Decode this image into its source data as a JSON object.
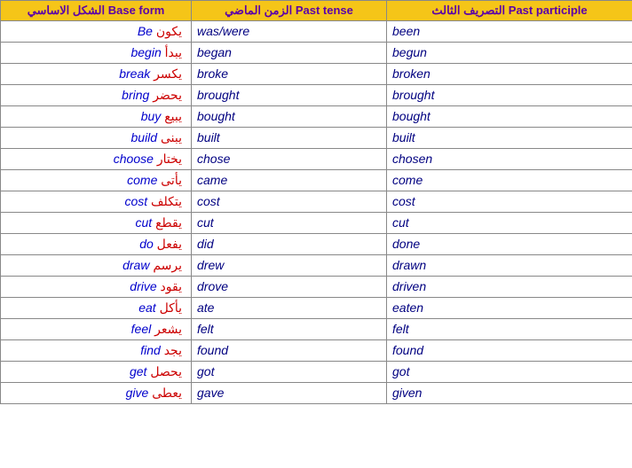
{
  "header": {
    "col1": {
      "en": "Base form",
      "ar": "الشكل الاساسي"
    },
    "col2": {
      "en": "Past tense",
      "ar": "الزمن الماضي"
    },
    "col3": {
      "en": "Past participle",
      "ar": "التصريف الثالث"
    }
  },
  "rows": [
    {
      "base_en": "Be",
      "base_ar": "يكون",
      "past": "was/were",
      "participle": "been"
    },
    {
      "base_en": "begin",
      "base_ar": "يبدأ",
      "past": "began",
      "participle": "begun"
    },
    {
      "base_en": "break",
      "base_ar": "يكسر",
      "past": "broke",
      "participle": "broken"
    },
    {
      "base_en": "bring",
      "base_ar": "يحضر",
      "past": "brought",
      "participle": "brought"
    },
    {
      "base_en": "buy",
      "base_ar": "يبيع",
      "past": "bought",
      "participle": "bought"
    },
    {
      "base_en": "build",
      "base_ar": "يبنى",
      "past": "built",
      "participle": "built"
    },
    {
      "base_en": "choose",
      "base_ar": "يختار",
      "past": "chose",
      "participle": "chosen"
    },
    {
      "base_en": "come",
      "base_ar": "يأتى",
      "past": "came",
      "participle": "come"
    },
    {
      "base_en": "cost",
      "base_ar": "يتكلف",
      "past": "cost",
      "participle": "cost"
    },
    {
      "base_en": "cut",
      "base_ar": "يقطع",
      "past": "cut",
      "participle": "cut"
    },
    {
      "base_en": "do",
      "base_ar": "يفعل",
      "past": "did",
      "participle": "done"
    },
    {
      "base_en": "draw",
      "base_ar": "يرسم",
      "past": "drew",
      "participle": "drawn"
    },
    {
      "base_en": "drive",
      "base_ar": "يقود",
      "past": "drove",
      "participle": "driven"
    },
    {
      "base_en": "eat",
      "base_ar": "يأكل",
      "past": "ate",
      "participle": "eaten"
    },
    {
      "base_en": "feel",
      "base_ar": "يشعر",
      "past": "felt",
      "participle": "felt"
    },
    {
      "base_en": "find",
      "base_ar": "يجد",
      "past": "found",
      "participle": "found"
    },
    {
      "base_en": "get",
      "base_ar": "يحصل",
      "past": "got",
      "participle": "got"
    },
    {
      "base_en": "give",
      "base_ar": "يعطى",
      "past": "gave",
      "participle": "given"
    }
  ]
}
